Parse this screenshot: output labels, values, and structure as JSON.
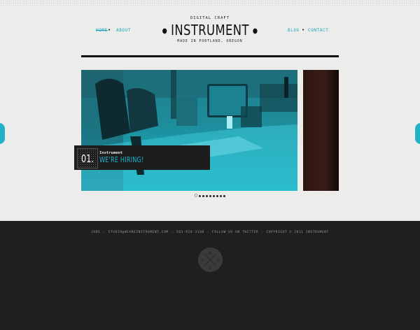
{
  "header": {
    "tagline": "DIGITAL CRAFT",
    "brand": "INSTRUMENT",
    "location": "MADE IN PORTLAND, OREGON",
    "nav_left": [
      "HOME",
      "ABOUT"
    ],
    "nav_right": [
      "BLOG",
      "CONTACT"
    ]
  },
  "slider": {
    "caption_number": "01.",
    "caption_title": "Instrument",
    "caption_subtitle": "WE'RE HIRING!",
    "dots": 9,
    "active_dot": 1
  },
  "footer": {
    "links": [
      "JOBS",
      "STUDIO@WEAREINSTRUMENT.COM",
      "503-928-3188",
      "FOLLOW US ON TWITTER",
      "COPYRIGHT © 2011 INSTRUMENT"
    ],
    "badge_letters": [
      "K",
      "O",
      "O",
      "O"
    ]
  },
  "colors": {
    "accent": "#1fb5cc",
    "footer_bg": "#1f1f1f",
    "page_bg": "#ececea"
  }
}
